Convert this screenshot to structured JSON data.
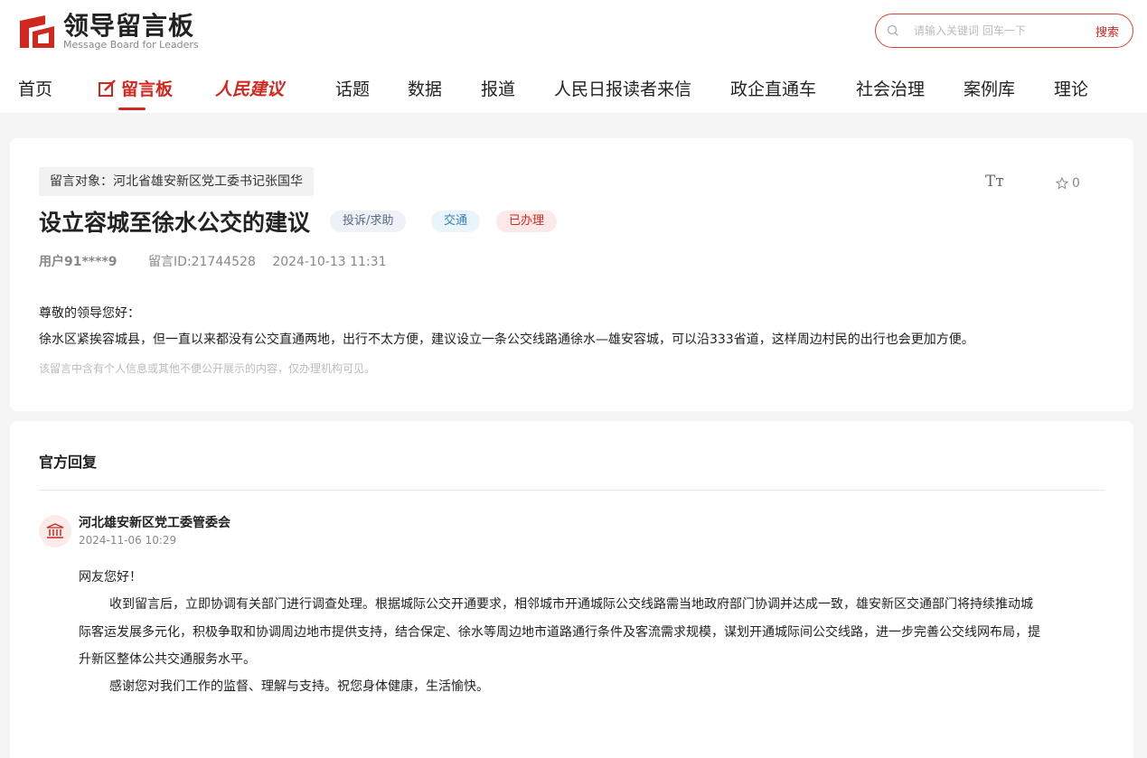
{
  "brand": {
    "title": "领导留言板",
    "subtitle": "Message Board for Leaders",
    "accent": "#d0281f"
  },
  "search": {
    "placeholder": "请输入关键词 回车一下",
    "button_label": "搜索"
  },
  "nav": {
    "items": [
      {
        "label": "首页"
      },
      {
        "label": "留言板",
        "active": true
      },
      {
        "label": "人民建议"
      },
      {
        "label": "话题"
      },
      {
        "label": "数据"
      },
      {
        "label": "报道"
      },
      {
        "label": "人民日报读者来信"
      },
      {
        "label": "政企直通车"
      },
      {
        "label": "社会治理"
      },
      {
        "label": "案例库"
      },
      {
        "label": "理论"
      }
    ]
  },
  "message": {
    "target": "留言对象：河北省雄安新区党工委书记张国华",
    "font_toggle": "Tт",
    "fav_count": "0",
    "title": "设立容城至徐水公交的建议",
    "tags": [
      "投诉/求助",
      "交通",
      "已办理"
    ],
    "user": "用户91****9",
    "id": "留言ID:21744528",
    "time": "2024-10-13 11:31",
    "greeting": "尊敬的领导您好：",
    "body": "徐水区紧挨容城县，但一直以来都没有公交直通两地，出行不太方便，建议设立一条公交线路通徐水—雄安容城，可以沿333省道，这样周边村民的出行也会更加方便。",
    "notice": "该留言中含有个人信息或其他不便公开展示的内容，仅办理机构可见。"
  },
  "reply": {
    "heading": "官方回复",
    "org": "河北雄安新区党工委管委会",
    "time": "2024-11-06 10:29",
    "p1": "网友您好！",
    "p2": "收到留言后，立即协调有关部门进行调查处理。根据城际公交开通要求，相邻城市开通城际公交线路需当地政府部门协调并达成一致，雄安新区交通部门将持续推动城",
    "p3": "际客运发展多元化，积极争取和协调周边地市提供支持，结合保定、徐水等周边地市道路通行条件及客流需求规模，谋划开通城际间公交线路，进一步完善公交线网布局，提",
    "p4": "升新区整体公共交通服务水平。",
    "p5": "感谢您对我们工作的监督、理解与支持。祝您身体健康，生活愉快。"
  }
}
